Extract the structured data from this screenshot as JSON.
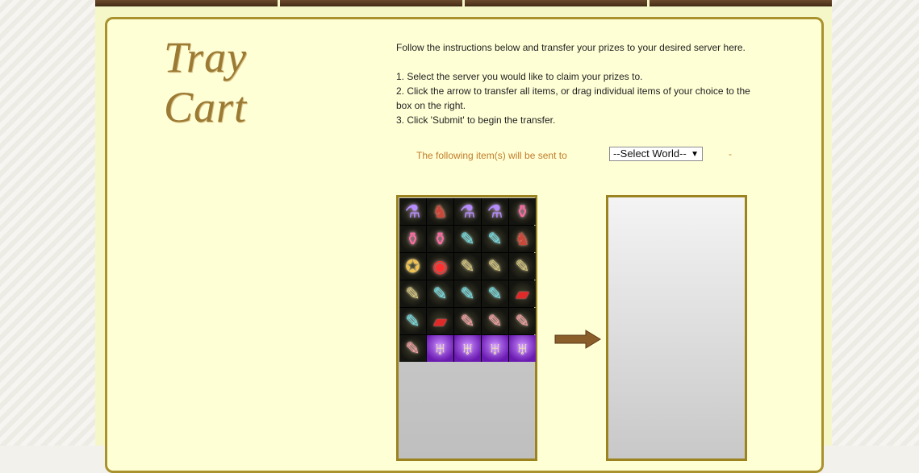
{
  "logo": {
    "text": "Tray Cart"
  },
  "instructions": {
    "intro": "Follow the instructions below and transfer your prizes to your desired server here.",
    "step1": "1. Select the server you would like to claim your prizes to.",
    "step2a": "2. Click the arrow to transfer all items, or drag individual items of your choice to the",
    "step2b": "box on the right.",
    "step3": "3. Click 'Submit' to begin the transfer."
  },
  "transfer": {
    "sent_label": "The following item(s) will be sent to",
    "world_select": "--Select World--",
    "dash": "-"
  },
  "inventory": {
    "items": [
      {
        "type": "purple-potion",
        "glyph": "⚗"
      },
      {
        "type": "red-knight",
        "glyph": "♞"
      },
      {
        "type": "purple-potion",
        "glyph": "⚗"
      },
      {
        "type": "purple-potion",
        "glyph": "⚗"
      },
      {
        "type": "pink-potion",
        "glyph": "⚱"
      },
      {
        "type": "pink-potion",
        "glyph": "⚱"
      },
      {
        "type": "pink-potion",
        "glyph": "⚱"
      },
      {
        "type": "cyan-scroll",
        "glyph": "✎"
      },
      {
        "type": "cyan-scroll",
        "glyph": "✎"
      },
      {
        "type": "red-knight",
        "glyph": "♞"
      },
      {
        "type": "gold-coin",
        "glyph": "✪"
      },
      {
        "type": "red-orb",
        "glyph": "◉"
      },
      {
        "type": "gold-scroll",
        "glyph": "✎"
      },
      {
        "type": "gold-scroll",
        "glyph": "✎"
      },
      {
        "type": "gold-scroll",
        "glyph": "✎"
      },
      {
        "type": "gold-scroll",
        "glyph": "✎"
      },
      {
        "type": "cyan-scroll",
        "glyph": "✎"
      },
      {
        "type": "cyan-scroll",
        "glyph": "✎"
      },
      {
        "type": "cyan-scroll",
        "glyph": "✎"
      },
      {
        "type": "red-book",
        "glyph": "▰"
      },
      {
        "type": "cyan-scroll",
        "glyph": "✎"
      },
      {
        "type": "red-book",
        "glyph": "▰"
      },
      {
        "type": "pink-scroll",
        "glyph": "✎"
      },
      {
        "type": "pink-scroll",
        "glyph": "✎"
      },
      {
        "type": "pink-scroll",
        "glyph": "✎"
      },
      {
        "type": "pink-scroll",
        "glyph": "✎"
      },
      {
        "type": "chalice",
        "glyph": "♅"
      },
      {
        "type": "chalice",
        "glyph": "♅"
      },
      {
        "type": "chalice",
        "glyph": "♅"
      },
      {
        "type": "chalice",
        "glyph": "♅"
      }
    ]
  },
  "colors": {
    "panel_bg": "#ffffd6",
    "panel_border": "#a9922e",
    "label_orange": "#c07c2a",
    "arrow_brown": "#8a5e2a"
  }
}
